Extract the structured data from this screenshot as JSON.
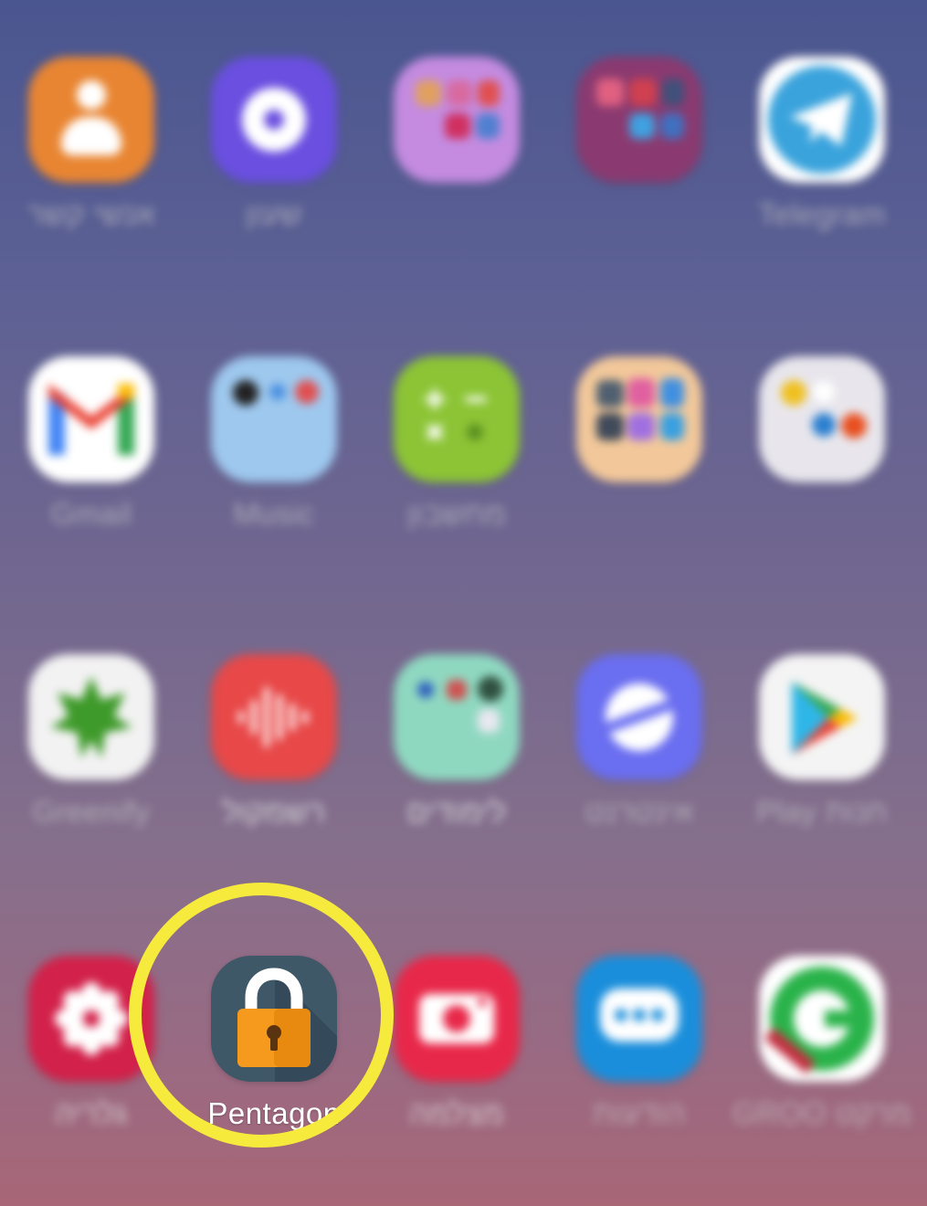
{
  "apps": [
    {
      "id": "contacts",
      "label": "אנשי קשר",
      "row": 0,
      "col": 0
    },
    {
      "id": "gallery-left",
      "label": "שעון",
      "row": 0,
      "col": 1
    },
    {
      "id": "folder-1",
      "label": "",
      "row": 0,
      "col": 2
    },
    {
      "id": "folder-2",
      "label": "",
      "row": 0,
      "col": 3
    },
    {
      "id": "telegram",
      "label": "Telegram",
      "row": 0,
      "col": 4
    },
    {
      "id": "gmail",
      "label": "Gmail",
      "row": 1,
      "col": 0
    },
    {
      "id": "music-folder",
      "label": "Music",
      "row": 1,
      "col": 1
    },
    {
      "id": "calculator",
      "label": "מחשבון",
      "row": 1,
      "col": 2
    },
    {
      "id": "folder-3",
      "label": "",
      "row": 1,
      "col": 3
    },
    {
      "id": "folder-4",
      "label": "",
      "row": 1,
      "col": 4
    },
    {
      "id": "greenify",
      "label": "Greenify",
      "row": 2,
      "col": 0
    },
    {
      "id": "recorder",
      "label": "רשמקול",
      "row": 2,
      "col": 1
    },
    {
      "id": "studies-folder",
      "label": "לימודים",
      "row": 2,
      "col": 2
    },
    {
      "id": "internet",
      "label": "אינטרנט",
      "row": 2,
      "col": 3
    },
    {
      "id": "play-store",
      "label": "Play חנות",
      "row": 2,
      "col": 4
    },
    {
      "id": "gallery",
      "label": "גלריה",
      "row": 3,
      "col": 0
    },
    {
      "id": "pentagon",
      "label": "Pentagon",
      "row": 3,
      "col": 1
    },
    {
      "id": "camera",
      "label": "מצלמה",
      "row": 3,
      "col": 2
    },
    {
      "id": "messages",
      "label": "הודעות",
      "row": 3,
      "col": 3
    },
    {
      "id": "groo",
      "label": "GROO מרקט",
      "row": 3,
      "col": 4
    }
  ],
  "highlight": {
    "target": "pentagon",
    "color": "#f6ea3d"
  }
}
